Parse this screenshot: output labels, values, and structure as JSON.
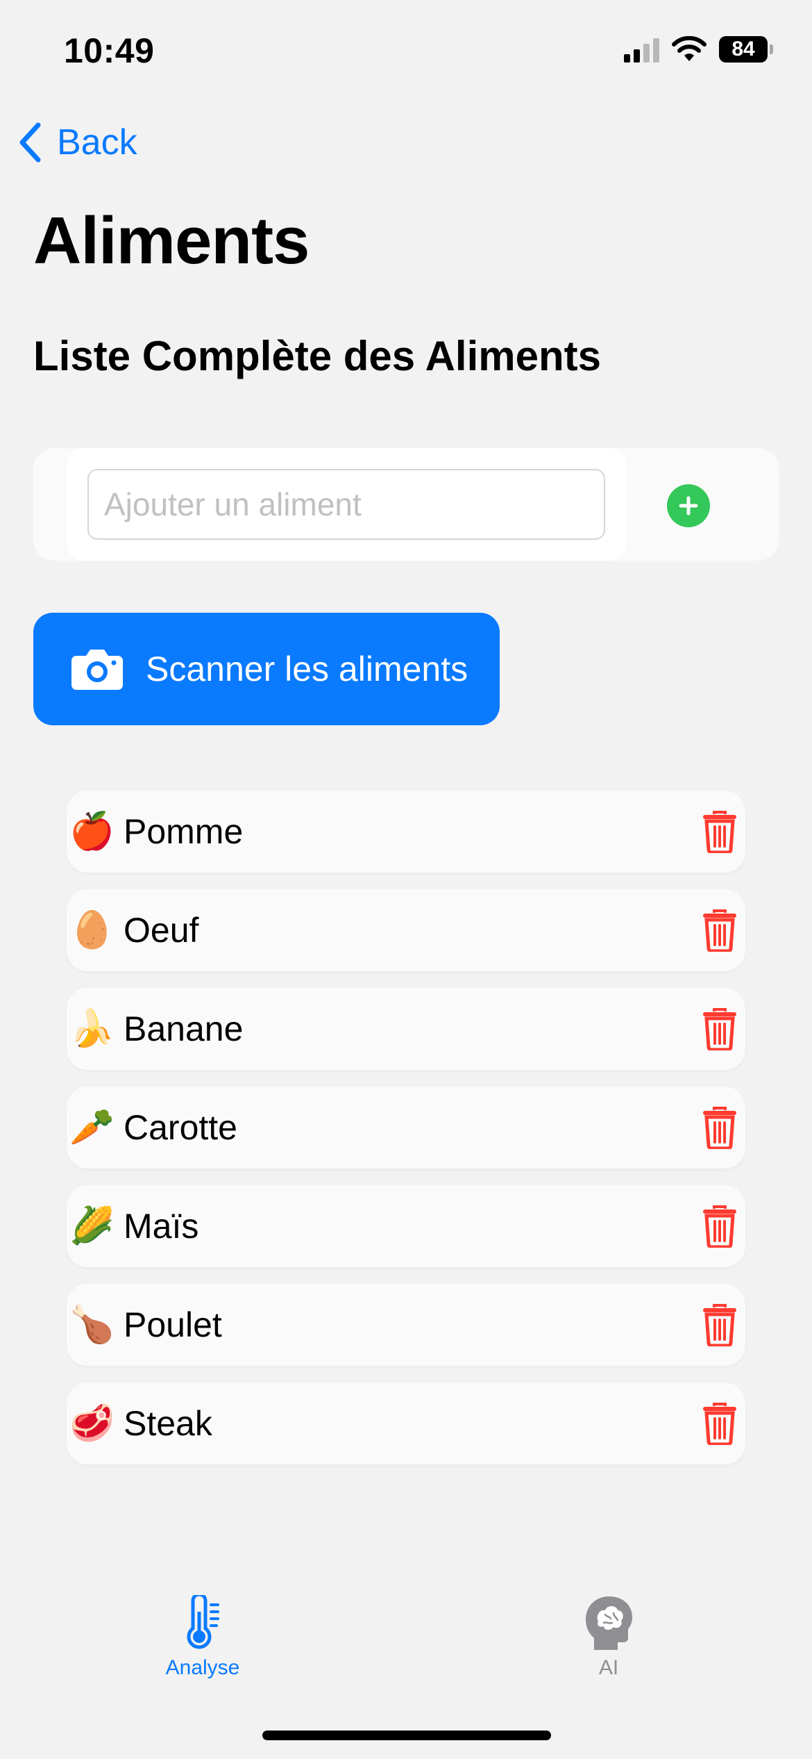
{
  "status_bar": {
    "time": "10:49",
    "battery": "84"
  },
  "nav": {
    "back_label": "Back"
  },
  "page": {
    "title": "Aliments",
    "subtitle": "Liste Complète des Aliments"
  },
  "add_food": {
    "placeholder": "Ajouter un aliment",
    "value": ""
  },
  "scan_button": {
    "label": "Scanner les aliments",
    "icon": "camera-icon"
  },
  "foods": [
    {
      "emoji": "🍎",
      "label": "Pomme"
    },
    {
      "emoji": "🥚",
      "label": "Oeuf"
    },
    {
      "emoji": "🍌",
      "label": "Banane"
    },
    {
      "emoji": "🥕",
      "label": "Carotte"
    },
    {
      "emoji": "🌽",
      "label": "Maïs"
    },
    {
      "emoji": "🍗",
      "label": "Poulet"
    },
    {
      "emoji": "🥩",
      "label": "Steak"
    }
  ],
  "tab_bar": {
    "tabs": [
      {
        "label": "Analyse",
        "icon": "thermometer-icon",
        "active": true
      },
      {
        "label": "AI",
        "icon": "brain-head-icon",
        "active": false
      }
    ]
  },
  "colors": {
    "accent": "#0a7aff",
    "add": "#34c759",
    "delete": "#ff3b30",
    "inactive": "#8e8e93"
  }
}
